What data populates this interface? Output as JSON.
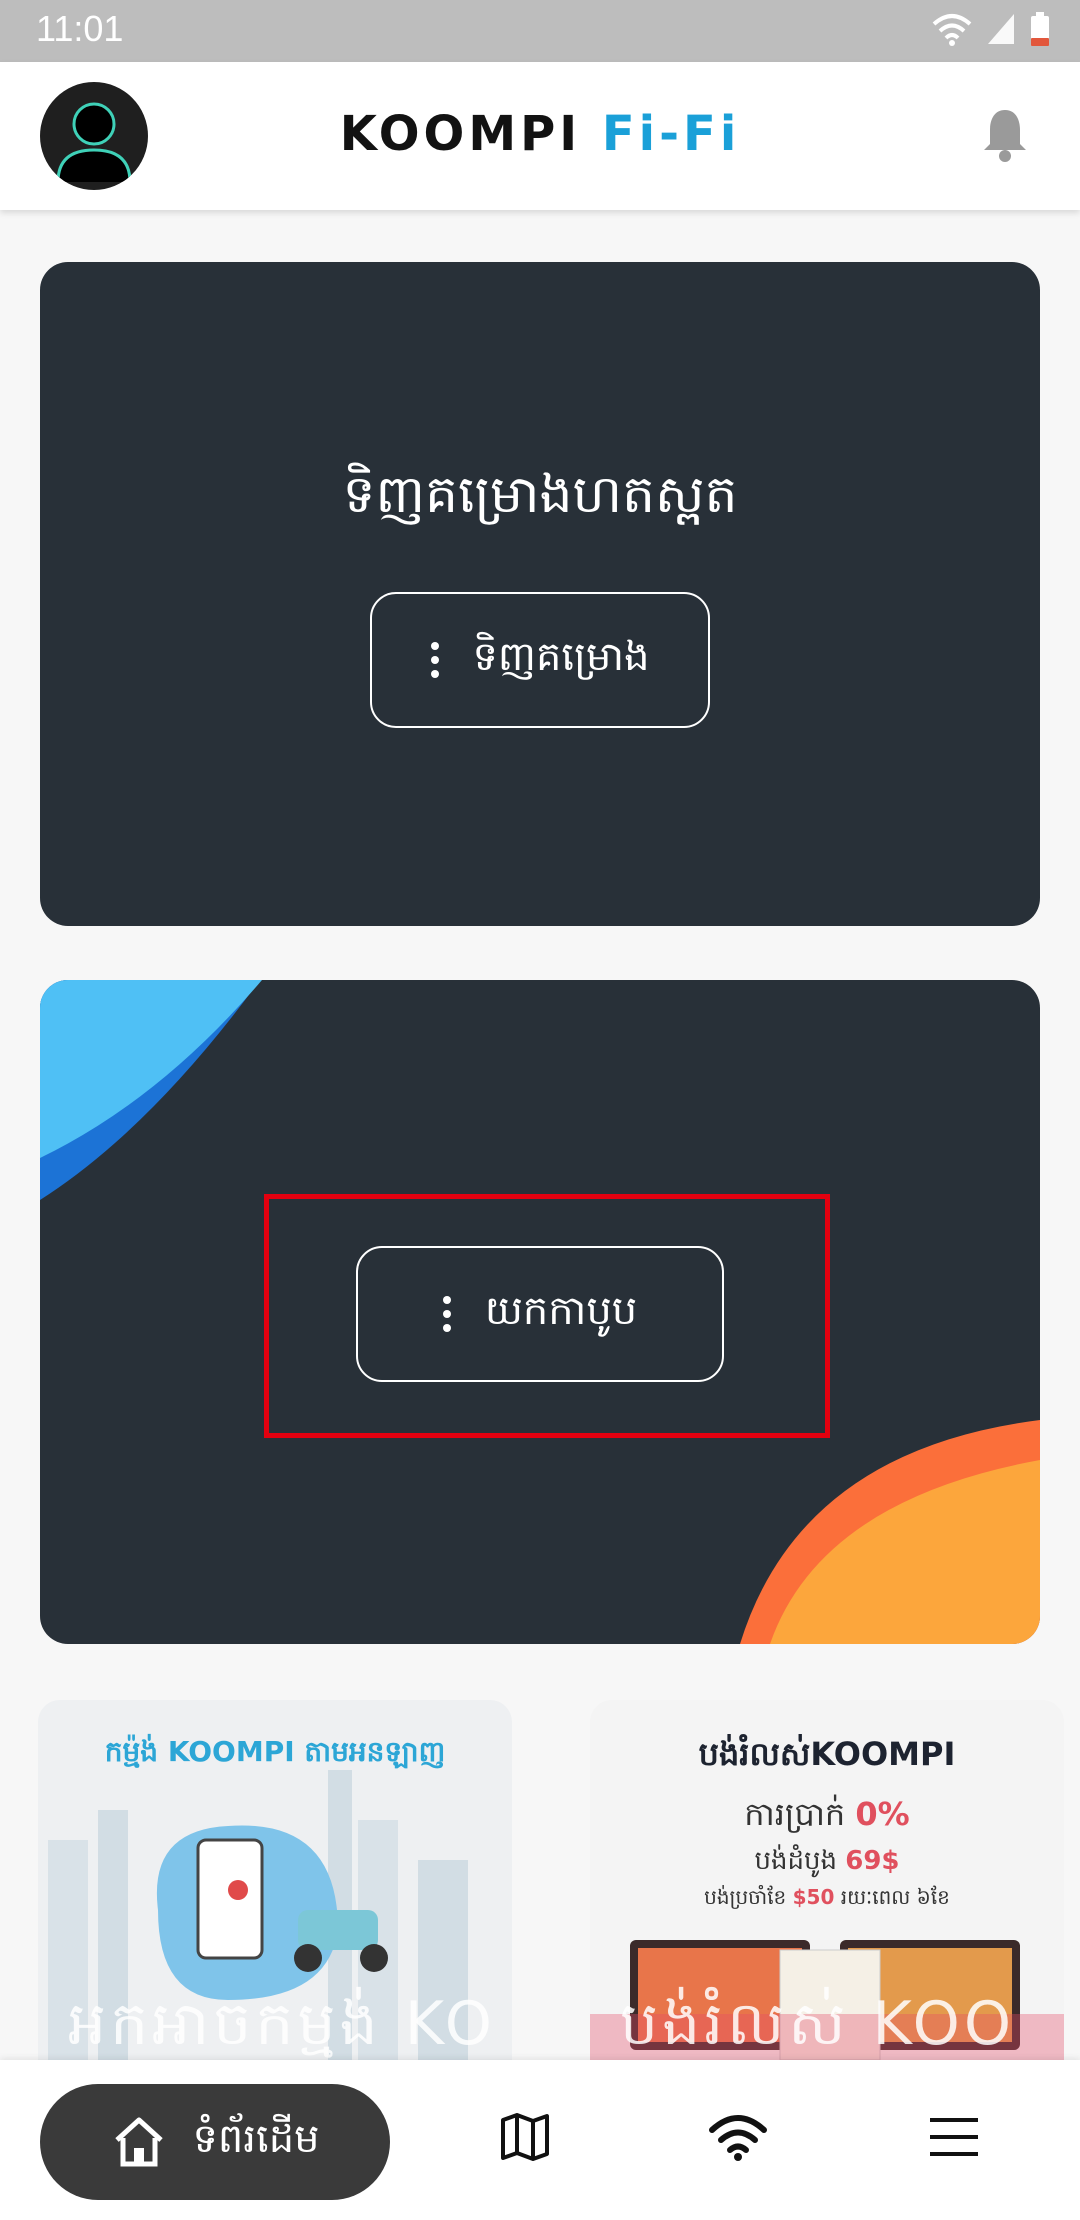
{
  "status_bar": {
    "time": "11:01"
  },
  "header": {
    "brand_main": "KOOMPI",
    "brand_accent": "Fi-Fi"
  },
  "cards": [
    {
      "title": "ទិញគម្រោងហតស្ពត",
      "button_label": "ទិញគម្រោង"
    },
    {
      "button_label": "យកកាបូប"
    }
  ],
  "promos": [
    {
      "headline": "កម្ម៉ង់ KOOMPI តាមអនឡាញ",
      "overlay_text": "អកអាចកម្មង់ KO"
    },
    {
      "headline": "បង់រំលស់KOOMPI",
      "rate_label": "ការប្រាក់",
      "rate_value": "0%",
      "first_payment_label": "បង់ដំបូង",
      "first_payment_value": "69$",
      "monthly_label": "បង់ប្រចាំខែ",
      "monthly_value": "$50",
      "period": "រយៈពេល ៦ខែ",
      "overlay_text": "បង់រំលស់ KOO"
    }
  ],
  "bottom_nav": {
    "home_label": "ទំព័រដើម"
  },
  "colors": {
    "brand_accent": "#1aa0d8",
    "card_bg": "#283038",
    "highlight": "#e3000f"
  },
  "icons": [
    "avatar-icon",
    "bell-icon",
    "more-vertical-icon",
    "home-icon",
    "map-icon",
    "wifi-icon",
    "menu-icon"
  ]
}
